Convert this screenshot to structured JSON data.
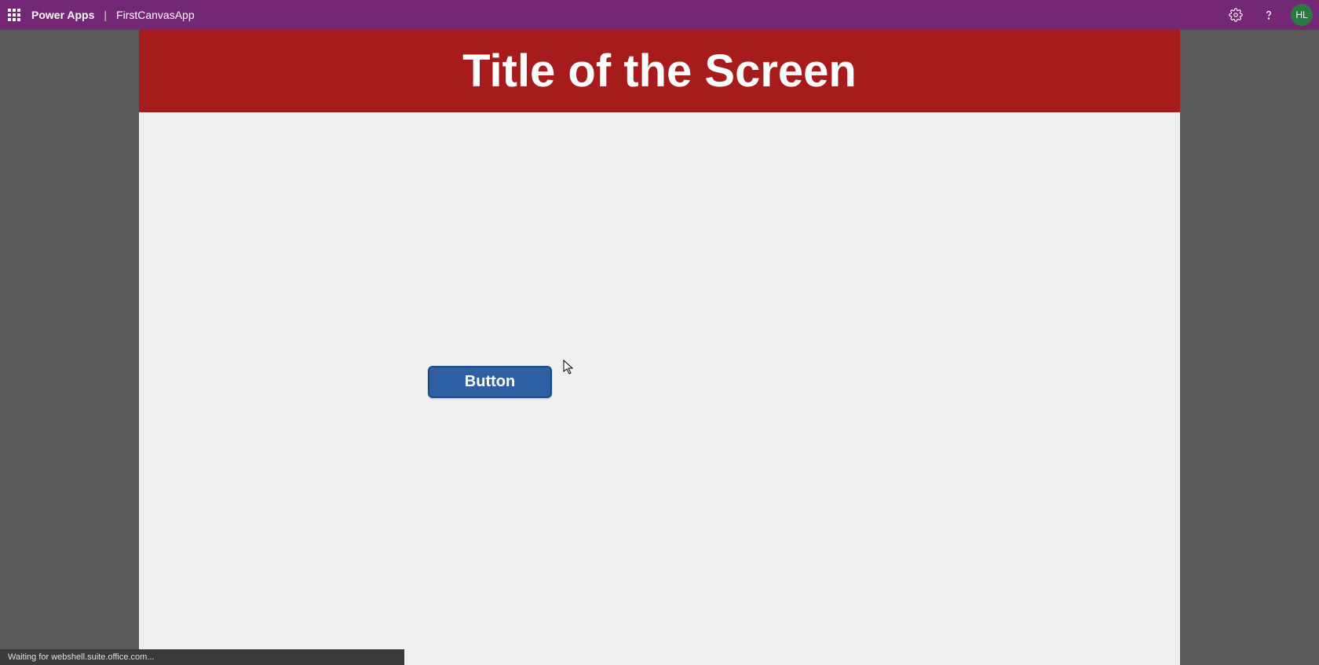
{
  "header": {
    "brand": "Power Apps",
    "separator": "|",
    "app_name": "FirstCanvasApp",
    "avatar_initials": "HL"
  },
  "screen": {
    "title": "Title of the Screen",
    "button_label": "Button"
  },
  "status": {
    "text": "Waiting for webshell.suite.office.com..."
  },
  "colors": {
    "header_bg": "#742774",
    "screen_header_bg": "#a61b1b",
    "button_bg": "#2e5fa3",
    "canvas_bg": "#f0f0f0",
    "outer_bg": "#595959",
    "avatar_bg": "#2a7a3f"
  }
}
